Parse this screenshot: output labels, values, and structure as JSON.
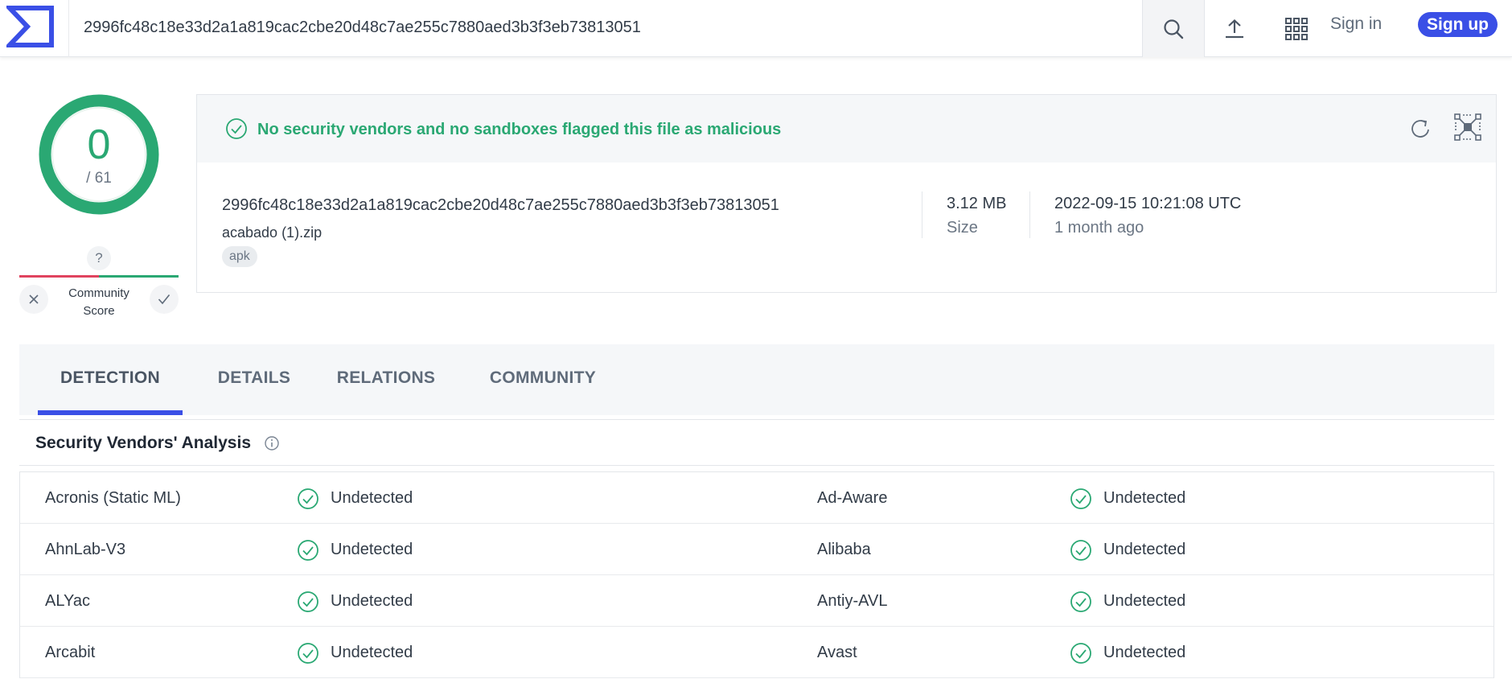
{
  "header": {
    "search_value": "2996fc48c18e33d2a1a819cac2cbe20d48c7ae255c7880aed3b3f3eb73813051",
    "sign_in": "Sign in",
    "sign_up": "Sign up"
  },
  "score": {
    "detections": "0",
    "total": "/ 61",
    "community_unknown": "?",
    "community_label": "Community Score"
  },
  "summary": {
    "status_message": "No security vendors and no sandboxes flagged this file as malicious",
    "hash": "2996fc48c18e33d2a1a819cac2cbe20d48c7ae255c7880aed3b3f3eb73813051",
    "file_name": "acabado (1).zip",
    "tag": "apk",
    "size_value": "3.12 MB",
    "size_label": "Size",
    "date_value": "2022-09-15 10:21:08 UTC",
    "date_relative": "1 month ago"
  },
  "tabs": [
    "DETECTION",
    "DETAILS",
    "RELATIONS",
    "COMMUNITY"
  ],
  "active_tab": "DETECTION",
  "analysis": {
    "title": "Security Vendors' Analysis",
    "rows": [
      {
        "left_vendor": "Acronis (Static ML)",
        "left_result": "Undetected",
        "right_vendor": "Ad-Aware",
        "right_result": "Undetected"
      },
      {
        "left_vendor": "AhnLab-V3",
        "left_result": "Undetected",
        "right_vendor": "Alibaba",
        "right_result": "Undetected"
      },
      {
        "left_vendor": "ALYac",
        "left_result": "Undetected",
        "right_vendor": "Antiy-AVL",
        "right_result": "Undetected"
      },
      {
        "left_vendor": "Arcabit",
        "left_result": "Undetected",
        "right_vendor": "Avast",
        "right_result": "Undetected"
      }
    ]
  },
  "colors": {
    "accent": "#3a4fe6",
    "clean": "#2aa873",
    "malicious": "#e0435e"
  },
  "icons": [
    "virustotal-logo",
    "search-icon",
    "upload-icon",
    "apps-grid-icon",
    "check-circle-icon",
    "reload-icon",
    "graph-icon",
    "info-icon",
    "close-icon",
    "check-icon"
  ]
}
